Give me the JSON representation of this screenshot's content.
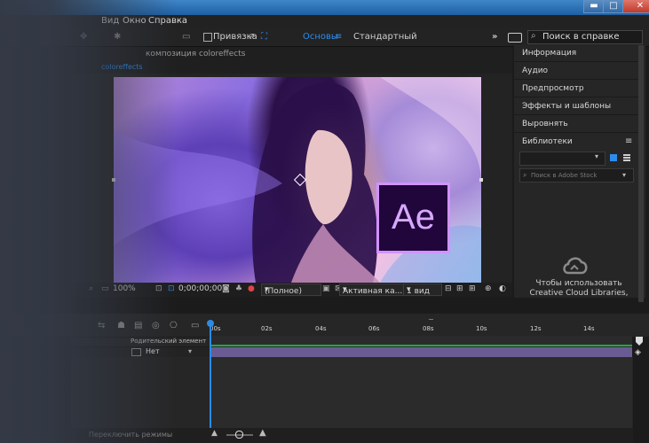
{
  "window": {
    "minimize_icon": "minimize-icon",
    "maximize_icon": "maximize-icon",
    "close_icon": "close-icon",
    "minimize_glyph": "▬",
    "maximize_glyph": "□",
    "close_glyph": "✕"
  },
  "menu": {
    "items": [
      "Вид",
      "Окно",
      "Справка"
    ]
  },
  "toolbar": {
    "snap_label": "Привязка",
    "workspace_main": "Основы",
    "workspace_standard": "Стандартный",
    "more_glyph": "»",
    "search_placeholder": "Поиск в справке"
  },
  "composition": {
    "title": "композиция coloreffects",
    "tab_label": "coloreffects",
    "logo_text": "Ae",
    "zoom": "100%",
    "timecode": "0;00;00;00",
    "resolution": "(Полное)",
    "camera": "Активная ка...",
    "views": "1 вид"
  },
  "right_panel": {
    "items": [
      "Информация",
      "Аудио",
      "Предпросмотр",
      "Эффекты и шаблоны",
      "Выровнять"
    ],
    "libraries_title": "Библиотеки",
    "stock_search": "Поиск в Adobe Stock",
    "message": "Чтобы использовать Creative Cloud Libraries,",
    "menu_glyph": "≡"
  },
  "timeline": {
    "ruler_labels": [
      "00s",
      "02s",
      "04s",
      "06s",
      "08s",
      "10s",
      "12s",
      "14s"
    ],
    "parent_header": "Родительский элемент",
    "parent_value": "Нет",
    "bottom_label": "Переключить режимы"
  },
  "colors": {
    "accent": "#2d8ceb",
    "layer_bar": "#6a5c93",
    "logo_border": "#d291ff",
    "logo_bg": "#20063b"
  }
}
